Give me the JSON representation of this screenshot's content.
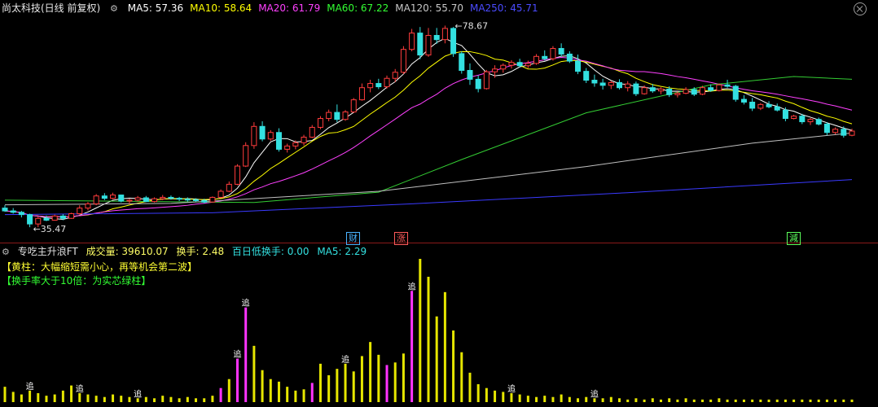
{
  "header": {
    "title": "尚太科技(日线 前复权)",
    "ma": [
      {
        "label": "MA5: 57.36",
        "color": "#ffffff"
      },
      {
        "label": "MA10: 58.64",
        "color": "#ffff00"
      },
      {
        "label": "MA20: 61.79",
        "color": "#ff40ff"
      },
      {
        "label": "MA60: 67.22",
        "color": "#33ff33"
      },
      {
        "label": "MA120: 55.70",
        "color": "#c8c8c8"
      },
      {
        "label": "MA250: 45.71",
        "color": "#4b4bff"
      }
    ]
  },
  "price_labels": {
    "high": "78.67",
    "low": "35.47"
  },
  "markers": [
    {
      "text": "财",
      "color": "#4ab3ff"
    },
    {
      "text": "涨",
      "color": "#ff5a5a"
    },
    {
      "text": "減",
      "color": "#5cff5c"
    }
  ],
  "volume_header": {
    "indicator": "专吃主升浪FT",
    "volume": "成交量: 39610.07",
    "turnover": "换手: 2.48",
    "low_turnover": "百日低换手: 0.00",
    "ma5": "MA5: 2.29"
  },
  "notes": [
    {
      "text": "【黄柱：大幅缩短需小心，再等机会第二波】",
      "color": "#ffff33"
    },
    {
      "text": "【换手率大于10倍：为实芯绿柱】",
      "color": "#33ff33"
    }
  ],
  "volume_tag": "追",
  "colors": {
    "up": "#ff3c3c",
    "down": "#33e0e0",
    "vol_yellow": "#e6e600",
    "vol_magenta": "#ff33ff"
  },
  "chart_data": {
    "type": "candlestick",
    "candles_ohlc": [
      [
        39.6,
        40.2,
        38.8,
        39.0
      ],
      [
        39.0,
        39.6,
        38.4,
        38.7
      ],
      [
        38.7,
        39.0,
        37.6,
        38.2
      ],
      [
        38.2,
        38.4,
        35.5,
        36.2
      ],
      [
        36.2,
        37.8,
        35.5,
        37.4
      ],
      [
        37.4,
        38.0,
        36.8,
        37.0
      ],
      [
        37.0,
        38.2,
        36.9,
        37.9
      ],
      [
        37.9,
        38.3,
        37.0,
        37.4
      ],
      [
        37.4,
        38.6,
        37.3,
        38.4
      ],
      [
        38.4,
        40.2,
        38.2,
        39.6
      ],
      [
        39.6,
        40.9,
        39.1,
        40.5
      ],
      [
        40.5,
        42.6,
        40.2,
        42.2
      ],
      [
        42.2,
        42.8,
        41.3,
        41.7
      ],
      [
        41.7,
        42.9,
        41.5,
        42.4
      ],
      [
        42.4,
        42.5,
        40.8,
        41.1
      ],
      [
        41.1,
        41.6,
        40.5,
        41.3
      ],
      [
        41.3,
        42.2,
        41.0,
        41.8
      ],
      [
        41.8,
        42.2,
        40.9,
        41.0
      ],
      [
        41.0,
        41.9,
        40.8,
        41.6
      ],
      [
        41.6,
        42.4,
        41.3,
        41.9
      ],
      [
        41.9,
        42.3,
        41.4,
        41.7
      ],
      [
        41.7,
        42.0,
        41.1,
        41.5
      ],
      [
        41.5,
        41.9,
        41.0,
        41.4
      ],
      [
        41.4,
        41.7,
        40.9,
        41.2
      ],
      [
        41.2,
        41.6,
        40.6,
        40.9
      ],
      [
        40.9,
        42.1,
        40.8,
        41.9
      ],
      [
        41.9,
        43.6,
        41.7,
        43.2
      ],
      [
        43.2,
        45.3,
        43.0,
        44.7
      ],
      [
        44.7,
        49.0,
        44.5,
        48.6
      ],
      [
        48.6,
        53.7,
        48.4,
        53.0
      ],
      [
        53.0,
        58.0,
        52.3,
        57.1
      ],
      [
        57.1,
        58.2,
        53.9,
        54.4
      ],
      [
        54.4,
        56.3,
        54.0,
        55.8
      ],
      [
        55.8,
        56.7,
        51.7,
        52.2
      ],
      [
        52.2,
        53.4,
        51.5,
        52.9
      ],
      [
        52.9,
        54.1,
        52.2,
        53.6
      ],
      [
        53.6,
        55.3,
        53.0,
        54.8
      ],
      [
        54.8,
        57.4,
        54.6,
        56.9
      ],
      [
        56.9,
        59.3,
        56.5,
        58.8
      ],
      [
        58.8,
        60.7,
        58.2,
        60.1
      ],
      [
        60.1,
        61.8,
        58.0,
        58.6
      ],
      [
        58.6,
        60.6,
        58.3,
        60.2
      ],
      [
        60.2,
        63.2,
        60.0,
        62.8
      ],
      [
        62.8,
        66.3,
        62.6,
        65.4
      ],
      [
        65.4,
        67.1,
        64.4,
        66.3
      ],
      [
        66.3,
        67.3,
        65.1,
        65.6
      ],
      [
        65.6,
        68.0,
        65.2,
        67.4
      ],
      [
        67.4,
        69.4,
        66.6,
        68.7
      ],
      [
        68.7,
        74.3,
        68.3,
        73.6
      ],
      [
        73.6,
        78.0,
        73.2,
        77.1
      ],
      [
        77.1,
        78.4,
        71.5,
        72.4
      ],
      [
        72.4,
        78.2,
        72.0,
        76.6
      ],
      [
        76.6,
        78.2,
        74.8,
        75.7
      ],
      [
        75.7,
        78.7,
        74.9,
        78.1
      ],
      [
        78.1,
        78.4,
        72.0,
        72.7
      ],
      [
        72.7,
        73.2,
        68.4,
        69.1
      ],
      [
        69.1,
        70.6,
        66.0,
        67.2
      ],
      [
        67.2,
        68.0,
        64.4,
        65.2
      ],
      [
        65.2,
        69.2,
        65.0,
        68.8
      ],
      [
        68.8,
        70.2,
        67.5,
        69.4
      ],
      [
        69.4,
        70.6,
        68.6,
        70.2
      ],
      [
        70.2,
        71.3,
        69.5,
        70.8
      ],
      [
        70.8,
        71.6,
        69.8,
        70.1
      ],
      [
        70.1,
        71.2,
        69.6,
        70.6
      ],
      [
        70.6,
        72.6,
        70.3,
        72.1
      ],
      [
        72.1,
        73.4,
        71.2,
        71.6
      ],
      [
        71.6,
        74.3,
        71.2,
        73.8
      ],
      [
        73.8,
        74.9,
        72.1,
        72.6
      ],
      [
        72.6,
        73.2,
        70.7,
        71.1
      ],
      [
        71.1,
        72.5,
        68.3,
        68.9
      ],
      [
        68.9,
        69.6,
        66.4,
        67.0
      ],
      [
        67.0,
        68.2,
        65.6,
        66.4
      ],
      [
        66.4,
        67.3,
        65.0,
        65.9
      ],
      [
        65.9,
        66.9,
        65.1,
        66.5
      ],
      [
        66.5,
        67.2,
        65.0,
        65.4
      ],
      [
        65.4,
        66.8,
        64.6,
        66.2
      ],
      [
        66.2,
        66.7,
        63.6,
        64.1
      ],
      [
        64.1,
        65.9,
        63.9,
        65.4
      ],
      [
        65.4,
        66.2,
        64.3,
        64.7
      ],
      [
        64.7,
        65.5,
        64.0,
        65.1
      ],
      [
        65.1,
        65.7,
        63.4,
        63.9
      ],
      [
        63.9,
        64.6,
        63.3,
        64.2
      ],
      [
        64.2,
        65.5,
        64.0,
        65.0
      ],
      [
        65.0,
        65.5,
        63.6,
        64.0
      ],
      [
        64.0,
        65.8,
        63.8,
        65.4
      ],
      [
        65.4,
        66.1,
        64.5,
        64.8
      ],
      [
        64.8,
        66.3,
        64.6,
        66.0
      ],
      [
        66.0,
        67.1,
        65.4,
        65.7
      ],
      [
        65.7,
        66.0,
        62.4,
        62.9
      ],
      [
        62.9,
        63.8,
        61.8,
        62.3
      ],
      [
        62.3,
        63.2,
        60.4,
        61.0
      ],
      [
        61.0,
        62.1,
        60.6,
        61.8
      ],
      [
        61.8,
        62.5,
        61.0,
        61.3
      ],
      [
        61.3,
        62.0,
        60.3,
        60.6
      ],
      [
        60.6,
        61.2,
        58.2,
        58.8
      ],
      [
        58.8,
        59.6,
        58.6,
        59.3
      ],
      [
        59.3,
        59.8,
        57.6,
        58.1
      ],
      [
        58.1,
        58.9,
        57.4,
        58.6
      ],
      [
        58.6,
        59.0,
        57.3,
        57.6
      ],
      [
        57.6,
        58.0,
        55.2,
        55.8
      ],
      [
        55.8,
        56.9,
        55.4,
        56.5
      ],
      [
        56.5,
        57.1,
        54.7,
        55.2
      ],
      [
        55.2,
        56.6,
        55.0,
        56.1
      ]
    ],
    "volume": [
      1.2,
      0.8,
      0.6,
      0.9,
      0.7,
      0.5,
      0.6,
      0.9,
      1.3,
      0.7,
      0.6,
      0.5,
      0.4,
      0.6,
      0.5,
      0.4,
      0.3,
      0.4,
      0.3,
      0.5,
      0.4,
      0.3,
      0.4,
      0.3,
      0.3,
      0.5,
      1.1,
      1.8,
      3.4,
      7.4,
      4.4,
      2.5,
      1.8,
      1.6,
      1.2,
      0.9,
      1.0,
      1.5,
      3.0,
      2.1,
      2.6,
      3.0,
      2.4,
      3.6,
      4.7,
      3.7,
      2.9,
      3.1,
      3.8,
      8.7,
      11.2,
      9.8,
      6.7,
      8.6,
      5.6,
      3.9,
      2.3,
      1.4,
      1.1,
      0.9,
      0.8,
      0.7,
      0.6,
      0.5,
      0.4,
      0.5,
      0.4,
      0.6,
      0.4,
      0.3,
      0.4,
      0.3,
      0.3,
      0.4,
      0.3,
      0.2,
      0.3,
      0.2,
      0.3,
      0.2,
      0.3,
      0.2,
      0.3,
      0.2,
      0.2,
      0.2,
      0.3,
      0.2,
      0.2,
      0.2,
      0.2,
      0.2,
      0.2,
      0.2,
      0.2,
      0.2,
      0.2,
      0.2,
      0.2,
      0.2,
      0.2,
      0.2,
      0.2
    ],
    "ylim": [
      35,
      80
    ]
  }
}
